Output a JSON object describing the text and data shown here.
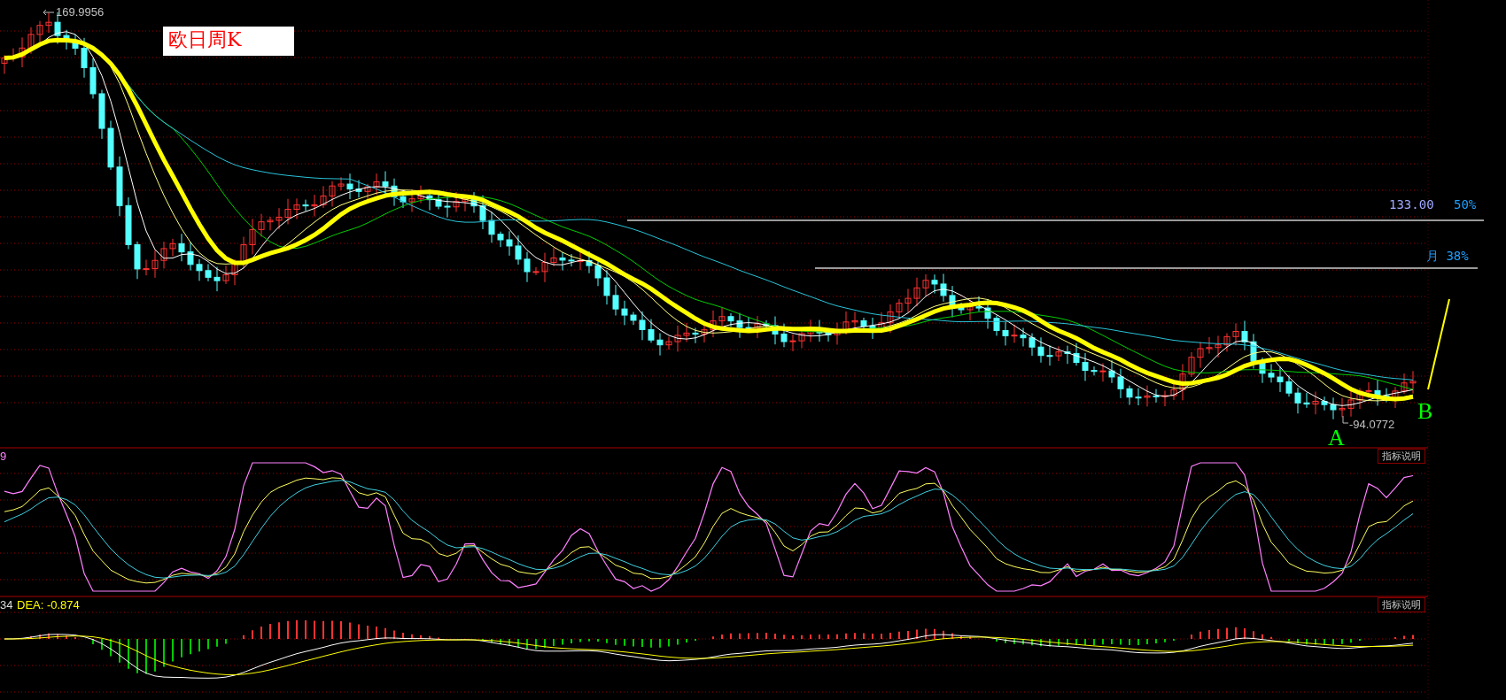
{
  "chart_title": "欧日周K",
  "high_label": "169.9956",
  "low_label": "-94.0772",
  "levels": [
    {
      "price": "133.00",
      "ratio": "50%"
    },
    {
      "ratio": "月 38%"
    }
  ],
  "points": [
    "A",
    "B"
  ],
  "kdj_panel": {
    "label": "9",
    "button": "指标说明"
  },
  "macd_panel": {
    "label": "34",
    "dea": "DEA: -0.874",
    "button": "指标说明"
  }
}
